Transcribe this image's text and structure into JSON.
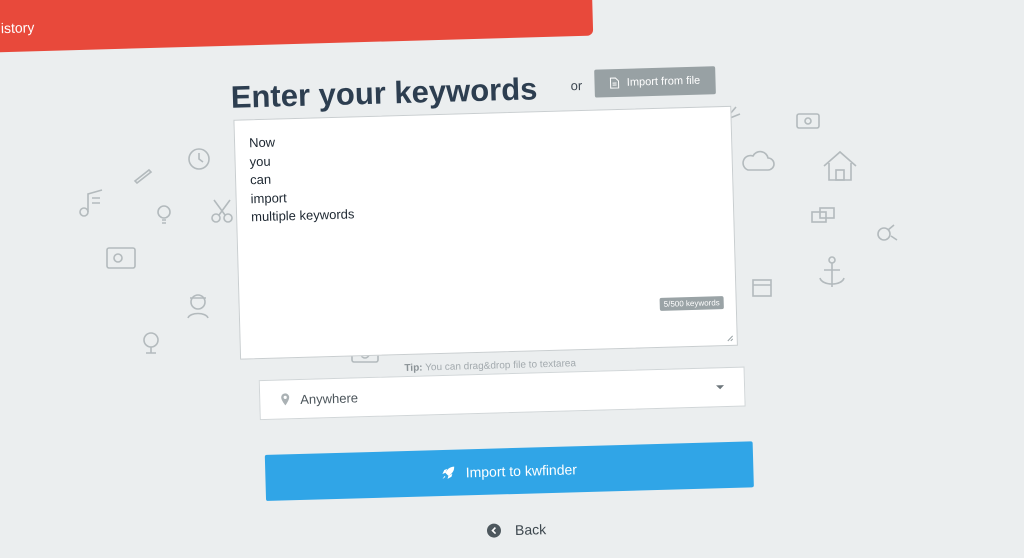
{
  "topbar": {
    "label": "History"
  },
  "heading": "Enter your keywords",
  "or_label": "or",
  "import_file_label": "Import from file",
  "textarea": {
    "lines": [
      "Now",
      "you",
      "can",
      "import",
      "multiple keywords"
    ],
    "count_badge": "5/500 keywords"
  },
  "tip": {
    "label": "Tip:",
    "text": "You can drag&drop file to textarea"
  },
  "location": {
    "value": "Anywhere"
  },
  "cta_label": "Import to kwfinder",
  "back_label": "Back",
  "colors": {
    "topbar": "#e8493b",
    "cta": "#30a5e7",
    "import_button": "#98a1a4",
    "heading": "#2d3e50",
    "background": "#ebeeef"
  },
  "icons": [
    "file-icon",
    "map-pin-icon",
    "rocket-icon",
    "arrow-left-icon",
    "chevron-down-icon"
  ]
}
